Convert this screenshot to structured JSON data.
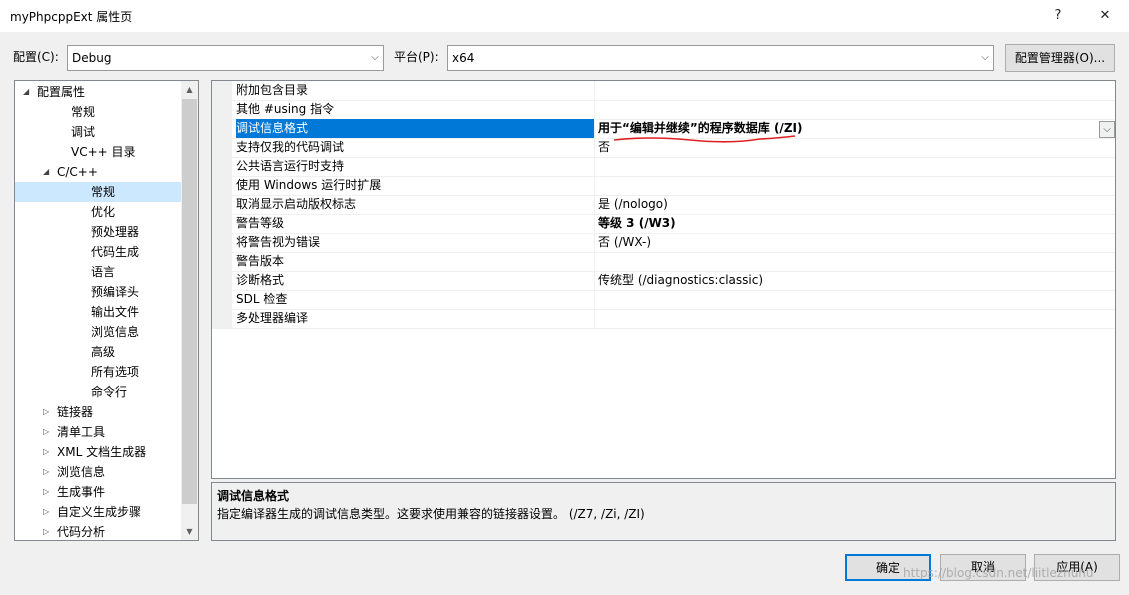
{
  "window": {
    "title": "myPhpcppExt 属性页",
    "help_glyph": "?",
    "close_glyph": "✕"
  },
  "header": {
    "config_label": "配置(C):",
    "config_value": "Debug",
    "platform_label": "平台(P):",
    "platform_value": "x64",
    "config_manager_label": "配置管理器(O)..."
  },
  "tree": {
    "items": [
      {
        "label": "配置属性",
        "expander": "◢"
      },
      {
        "label": "常规",
        "expander": ""
      },
      {
        "label": "调试",
        "expander": ""
      },
      {
        "label": "VC++ 目录",
        "expander": ""
      },
      {
        "label": "C/C++",
        "expander": "◢"
      },
      {
        "label": "常规",
        "expander": ""
      },
      {
        "label": "优化",
        "expander": ""
      },
      {
        "label": "预处理器",
        "expander": ""
      },
      {
        "label": "代码生成",
        "expander": ""
      },
      {
        "label": "语言",
        "expander": ""
      },
      {
        "label": "预编译头",
        "expander": ""
      },
      {
        "label": "输出文件",
        "expander": ""
      },
      {
        "label": "浏览信息",
        "expander": ""
      },
      {
        "label": "高级",
        "expander": ""
      },
      {
        "label": "所有选项",
        "expander": ""
      },
      {
        "label": "命令行",
        "expander": ""
      },
      {
        "label": "链接器",
        "expander": "▷"
      },
      {
        "label": "清单工具",
        "expander": "▷"
      },
      {
        "label": "XML 文档生成器",
        "expander": "▷"
      },
      {
        "label": "浏览信息",
        "expander": "▷"
      },
      {
        "label": "生成事件",
        "expander": "▷"
      },
      {
        "label": "自定义生成步骤",
        "expander": "▷"
      },
      {
        "label": "代码分析",
        "expander": "▷"
      }
    ],
    "scroll_up": "▲",
    "scroll_down": "▼"
  },
  "grid": {
    "rows": [
      {
        "name": "附加包含目录",
        "value": ""
      },
      {
        "name": "其他 #using 指令",
        "value": ""
      },
      {
        "name": "调试信息格式",
        "value": "用于“编辑并继续”的程序数据库 (/ZI)"
      },
      {
        "name": "支持仅我的代码调试",
        "value": "否"
      },
      {
        "name": "公共语言运行时支持",
        "value": ""
      },
      {
        "name": "使用 Windows 运行时扩展",
        "value": ""
      },
      {
        "name": "取消显示启动版权标志",
        "value": "是 (/nologo)"
      },
      {
        "name": "警告等级",
        "value": "等级 3 (/W3)"
      },
      {
        "name": "将警告视为错误",
        "value": "否 (/WX-)"
      },
      {
        "name": "警告版本",
        "value": ""
      },
      {
        "name": "诊断格式",
        "value": "传统型 (/diagnostics:classic)"
      },
      {
        "name": "SDL 检查",
        "value": ""
      },
      {
        "name": "多处理器编译",
        "value": ""
      }
    ]
  },
  "description": {
    "title": "调试信息格式",
    "text": "指定编译器生成的调试信息类型。这要求使用兼容的链接器设置。  (/Z7, /Zi, /ZI)"
  },
  "footer": {
    "ok_label": "确定",
    "cancel_label": "取消",
    "apply_label": "应用(A)"
  },
  "watermark": "https://blog.csdn.net/liitlezhuhu",
  "colors": {
    "selection": "#0078d7",
    "tree_selection": "#cce8ff",
    "annotation": "#e02020"
  }
}
